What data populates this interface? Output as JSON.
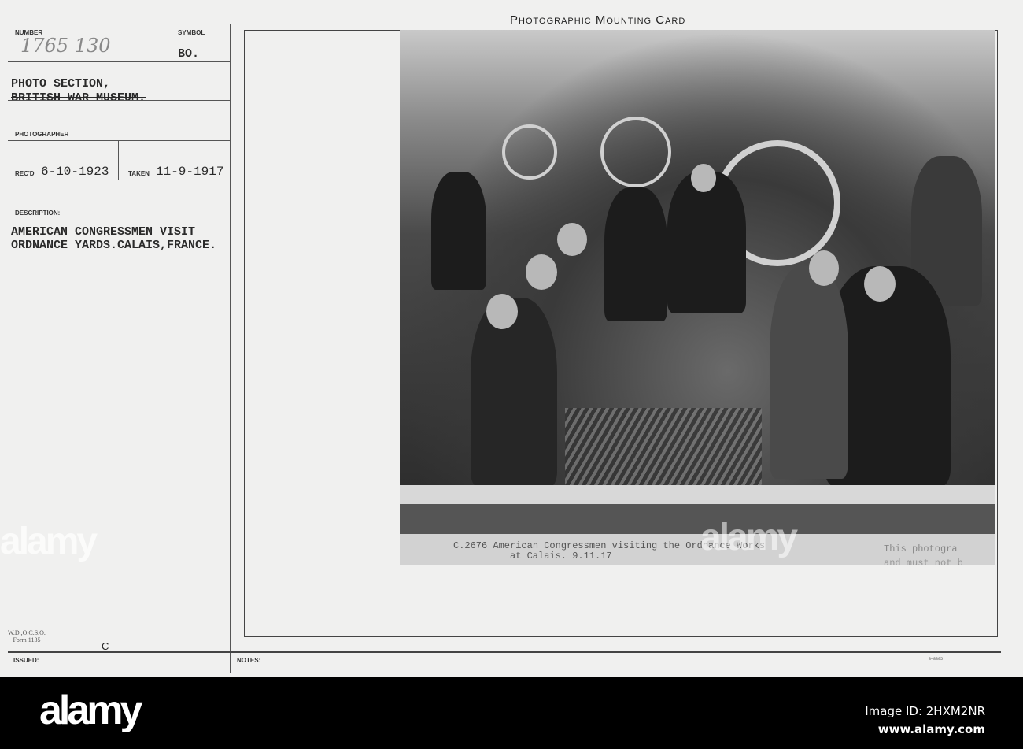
{
  "card": {
    "title": "Photographic Mounting Card",
    "number_label": "NUMBER",
    "number_value": "1765 130",
    "symbol_label": "SYMBOL",
    "symbol_value": "BO.",
    "section_line1": "PHOTO SECTION,",
    "section_line2": "BRITISH WAR MUSEUM.",
    "photographer_label": "PHOTOGRAPHER",
    "recd_label": "REC'D",
    "recd_value": "6-10-1923",
    "taken_label": "TAKEN",
    "taken_value": "11-9-1917",
    "description_label": "DESCRIPTION:",
    "description_line1": "AMERICAN CONGRESSMEN VISIT",
    "description_line2": "ORDNANCE YARDS.CALAIS,FRANCE.",
    "form_line1": "W.D.,O.C.S.O.",
    "form_line2": "Form 1135",
    "issued_mark": "C",
    "issued_label": "ISSUED:",
    "notes_label": "NOTES:",
    "print_code": "3—8805"
  },
  "photo": {
    "caption_line1": "C.2676 American Congressmen visiting the Ordnance Works",
    "caption_line2": "at Calais.  9.11.17",
    "side_text1": "This photogra",
    "side_text2": "and must not b"
  },
  "watermark": {
    "brand": "alamy",
    "image_id": "Image ID: 2HXM2NR",
    "url": "www.alamy.com"
  }
}
